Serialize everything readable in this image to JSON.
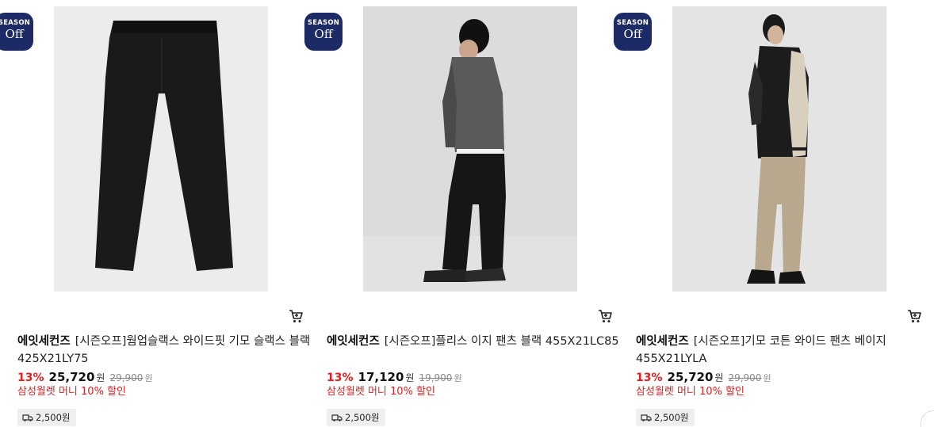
{
  "products": [
    {
      "badge": {
        "season": "SEASON",
        "off": "Off"
      },
      "brand": "에잇세컨즈",
      "title": "[시즌오프]웜업슬랙스 와이드핏 기모 슬랙스 블랙 425X21LY75",
      "discount": "13%",
      "price": "25,720",
      "price_unit": "원",
      "original_price": "29,900",
      "original_unit": "원",
      "promo": "삼성월렛 머니 10% 할인",
      "shipping": "2,500원",
      "image": "black-wide-slacks"
    },
    {
      "badge": {
        "season": "SEASON",
        "off": "Off"
      },
      "brand": "에잇세컨즈",
      "title": "[시즌오프]플리스 이지 팬츠 블랙 455X21LC85",
      "discount": "13%",
      "price": "17,120",
      "price_unit": "원",
      "original_price": "19,900",
      "original_unit": "원",
      "promo": "삼성월렛 머니 10% 할인",
      "shipping": "2,500원",
      "image": "model-black-fleece-pants"
    },
    {
      "badge": {
        "season": "SEASON",
        "off": "Off"
      },
      "brand": "에잇세컨즈",
      "title": "[시즌오프]기모 코튼 와이드 팬츠 베이지 455X21LYLA",
      "discount": "13%",
      "price": "25,720",
      "price_unit": "원",
      "original_price": "29,900",
      "original_unit": "원",
      "promo": "삼성월렛 머니 10% 할인",
      "shipping": "2,500원",
      "image": "model-beige-cotton-pants"
    }
  ],
  "colors": {
    "badge": "#1c2a66",
    "discount": "#e01e1e",
    "promo": "#e01e1e"
  },
  "icons": [
    "season-off-badge",
    "cart-icon",
    "truck-icon"
  ]
}
